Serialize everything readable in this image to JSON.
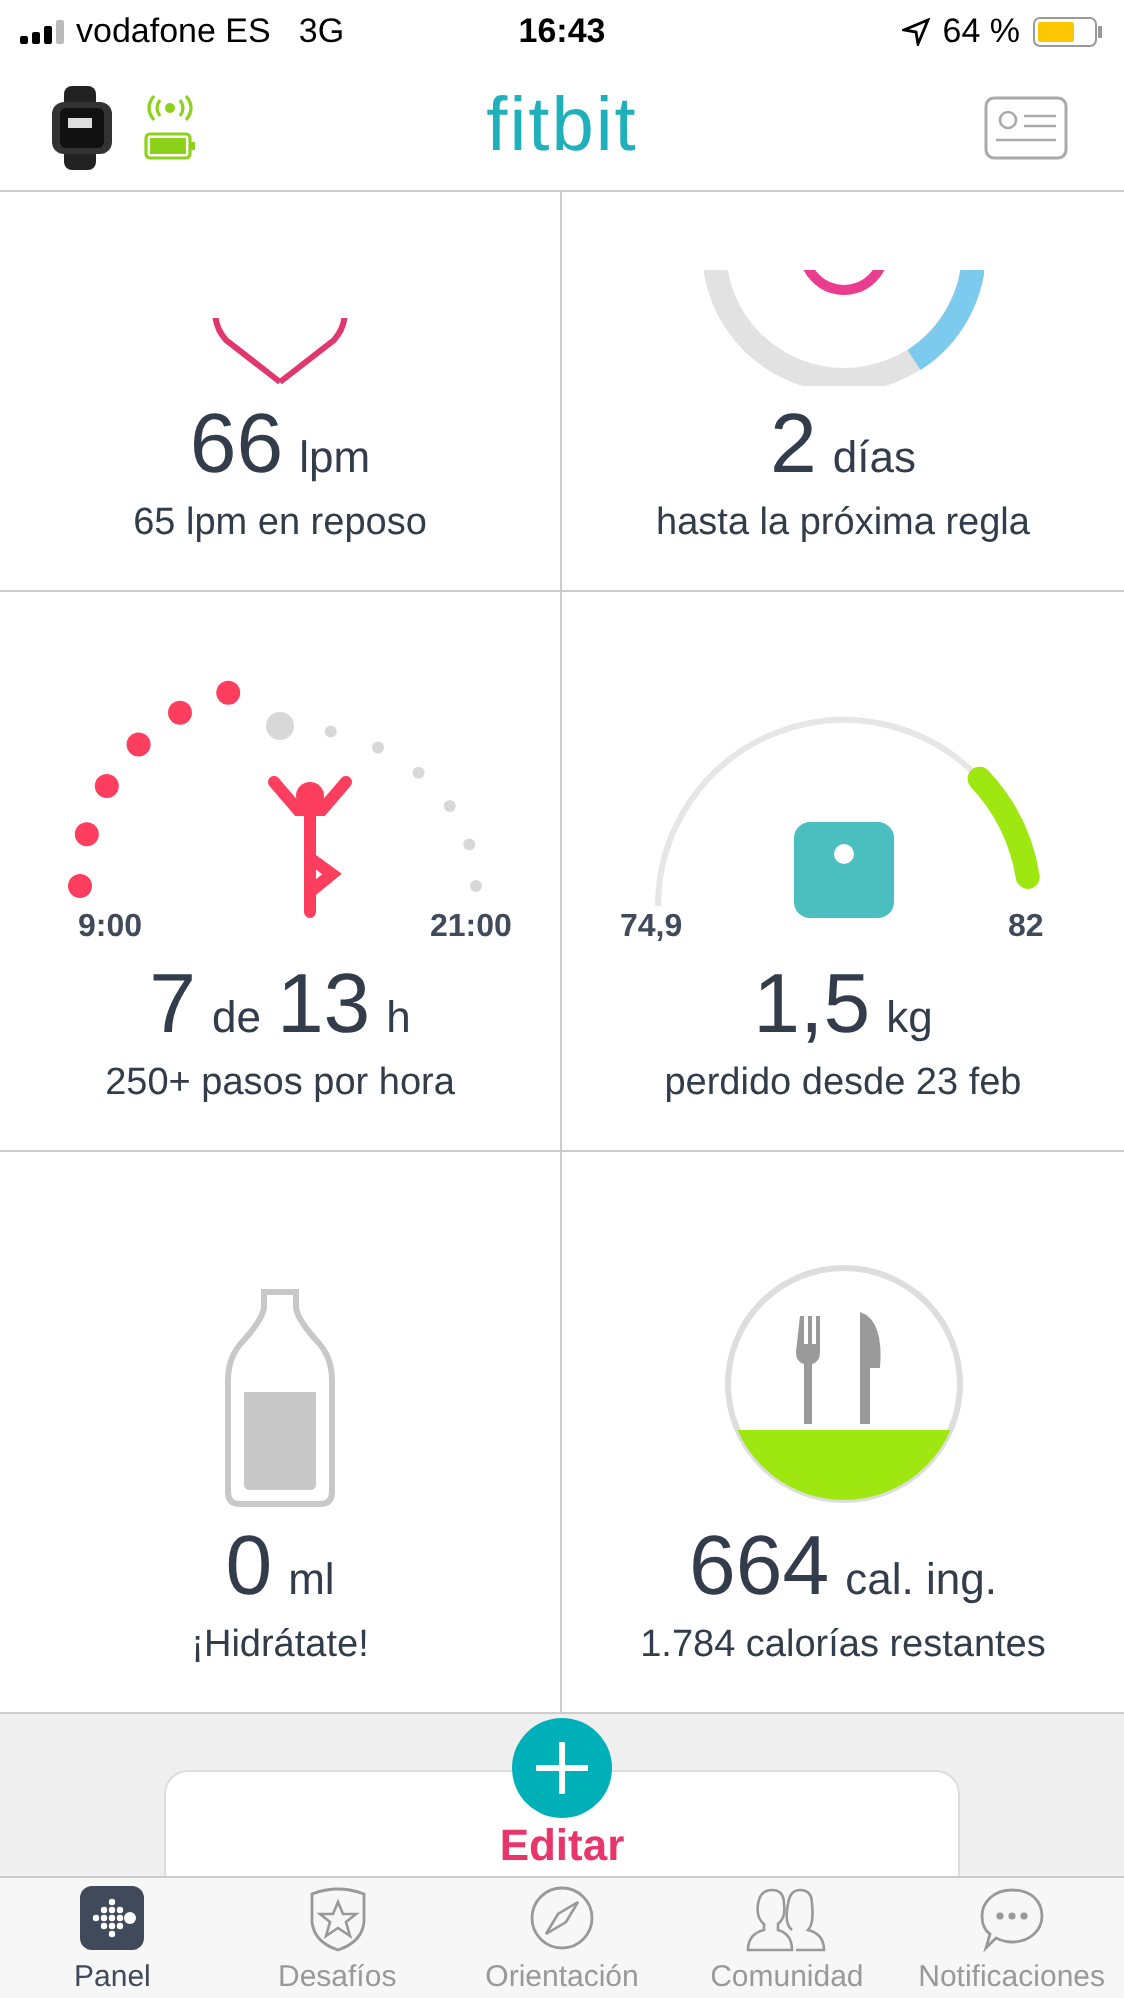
{
  "status_bar": {
    "carrier": "vodafone ES",
    "network": "3G",
    "time": "16:43",
    "battery": "64 %"
  },
  "header": {
    "logo": "fitbit"
  },
  "tiles": [
    {
      "kind": "heart",
      "value": "66",
      "unit": "lpm",
      "subtitle": "65 lpm en reposo"
    },
    {
      "kind": "cycle",
      "value": "2",
      "unit": "días",
      "subtitle": "hasta la próxima regla"
    },
    {
      "kind": "hourly",
      "value": "7",
      "joiner": "de",
      "value2": "13",
      "unit": "h",
      "subtitle": "250+ pasos por hora",
      "start": "9:00",
      "end": "21:00",
      "hours": [
        {
          "kind": "met"
        },
        {
          "kind": "met"
        },
        {
          "kind": "met"
        },
        {
          "kind": "met"
        },
        {
          "kind": "met"
        },
        {
          "kind": "met"
        },
        {
          "kind": "current"
        },
        {
          "kind": "upcoming"
        },
        {
          "kind": "upcoming"
        },
        {
          "kind": "upcoming"
        },
        {
          "kind": "upcoming"
        },
        {
          "kind": "upcoming"
        },
        {
          "kind": "upcoming"
        }
      ]
    },
    {
      "kind": "weight",
      "value": "1,5",
      "unit": "kg",
      "subtitle": "perdido desde 23 feb",
      "start": "74,9",
      "end": "82"
    },
    {
      "kind": "water",
      "value": "0",
      "unit": "ml",
      "subtitle": "¡Hidrátate!"
    },
    {
      "kind": "food",
      "value": "664",
      "unit": "cal. ing.",
      "subtitle": "1.784 calorías restantes"
    }
  ],
  "edit_card": {
    "label": "Editar"
  },
  "tabs": [
    {
      "label": "Panel",
      "selected": true
    },
    {
      "label": "Desafíos",
      "selected": false
    },
    {
      "label": "Orientación",
      "selected": false
    },
    {
      "label": "Comunidad",
      "selected": false
    },
    {
      "label": "Notificaciones",
      "selected": false
    }
  ]
}
